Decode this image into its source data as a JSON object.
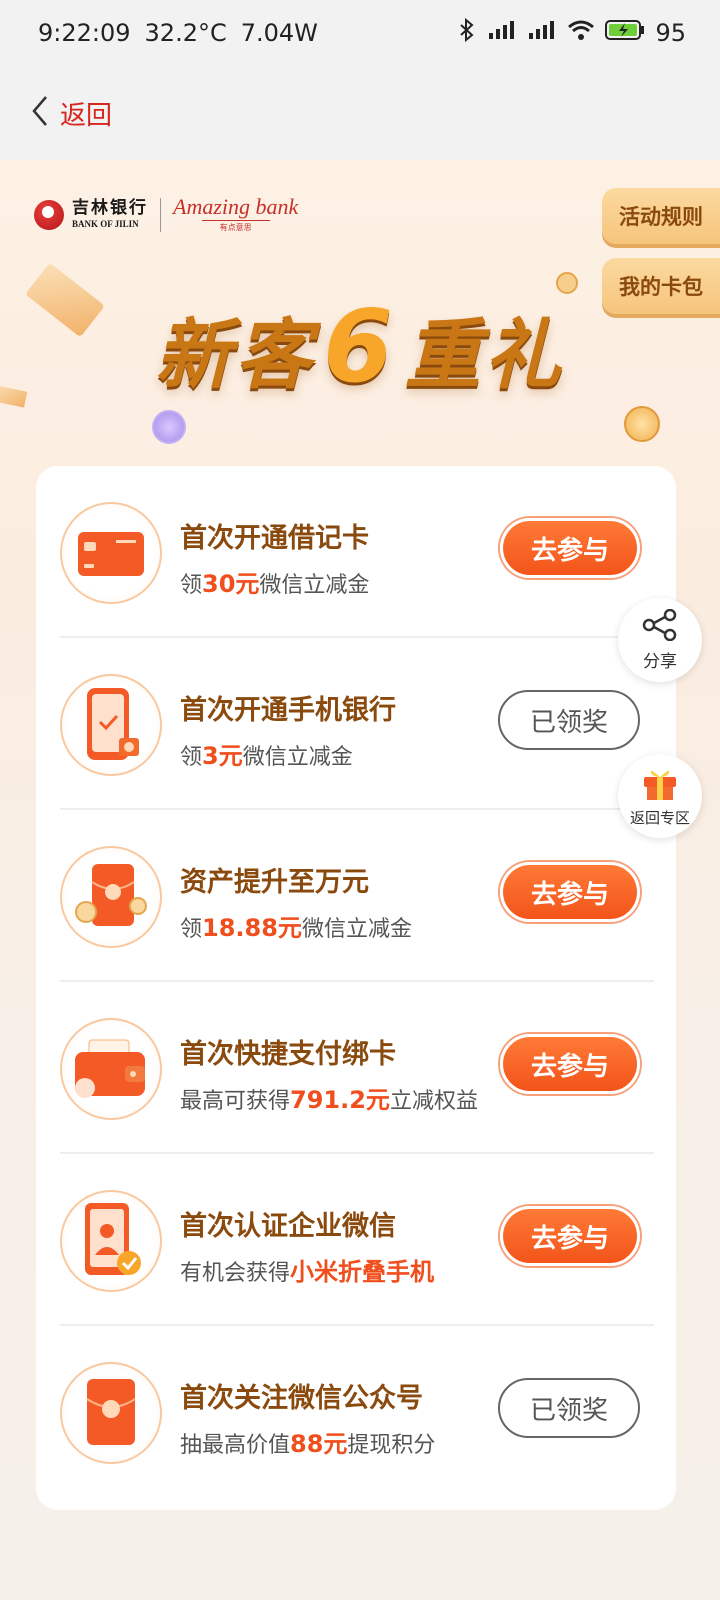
{
  "status": {
    "time": "9:22:09",
    "temp": "32.2°C",
    "power": "7.04W",
    "battery": "95"
  },
  "nav": {
    "back_label": "返回"
  },
  "brand": {
    "bank_cn": "吉林银行",
    "bank_en": "BANK OF JILIN",
    "slogan": "Amazing bank",
    "slogan_sub": "有点意思"
  },
  "side_tabs": {
    "rules": "活动规则",
    "cards": "我的卡包"
  },
  "hero": {
    "title_left": "新客",
    "title_num": "6",
    "title_right": "重礼"
  },
  "tasks": [
    {
      "title": "首次开通借记卡",
      "desc_pre": "领",
      "desc_hl": "30元",
      "desc_post": "微信立减金",
      "button": "去参与",
      "state": "join",
      "icon": "debit-card-icon"
    },
    {
      "title": "首次开通手机银行",
      "desc_pre": "领",
      "desc_hl": "3元",
      "desc_post": "微信立减金",
      "button": "已领奖",
      "state": "done",
      "icon": "mobile-bank-icon"
    },
    {
      "title": "资产提升至万元",
      "desc_pre": "领",
      "desc_hl": "18.88元",
      "desc_post": "微信立减金",
      "button": "去参与",
      "state": "join",
      "icon": "red-envelope-icon"
    },
    {
      "title": "首次快捷支付绑卡",
      "desc_pre": "最高可获得",
      "desc_hl": "791.2元",
      "desc_post": "立减权益",
      "button": "去参与",
      "state": "join",
      "icon": "wallet-icon"
    },
    {
      "title": "首次认证企业微信",
      "desc_pre": "有机会获得",
      "desc_hl": "小米折叠手机",
      "desc_post": "",
      "button": "去参与",
      "state": "join",
      "icon": "id-verify-icon"
    },
    {
      "title": "首次关注微信公众号",
      "desc_pre": "抽最高价值",
      "desc_hl": "88元",
      "desc_post": "提现积分",
      "button": "已领奖",
      "state": "done",
      "icon": "yuan-envelope-icon"
    }
  ],
  "float": {
    "share": "分享",
    "back_zone": "返回专区"
  },
  "colors": {
    "accent": "#f3541a",
    "brand_red": "#d6261e",
    "title_brown": "#8a4a0e"
  }
}
